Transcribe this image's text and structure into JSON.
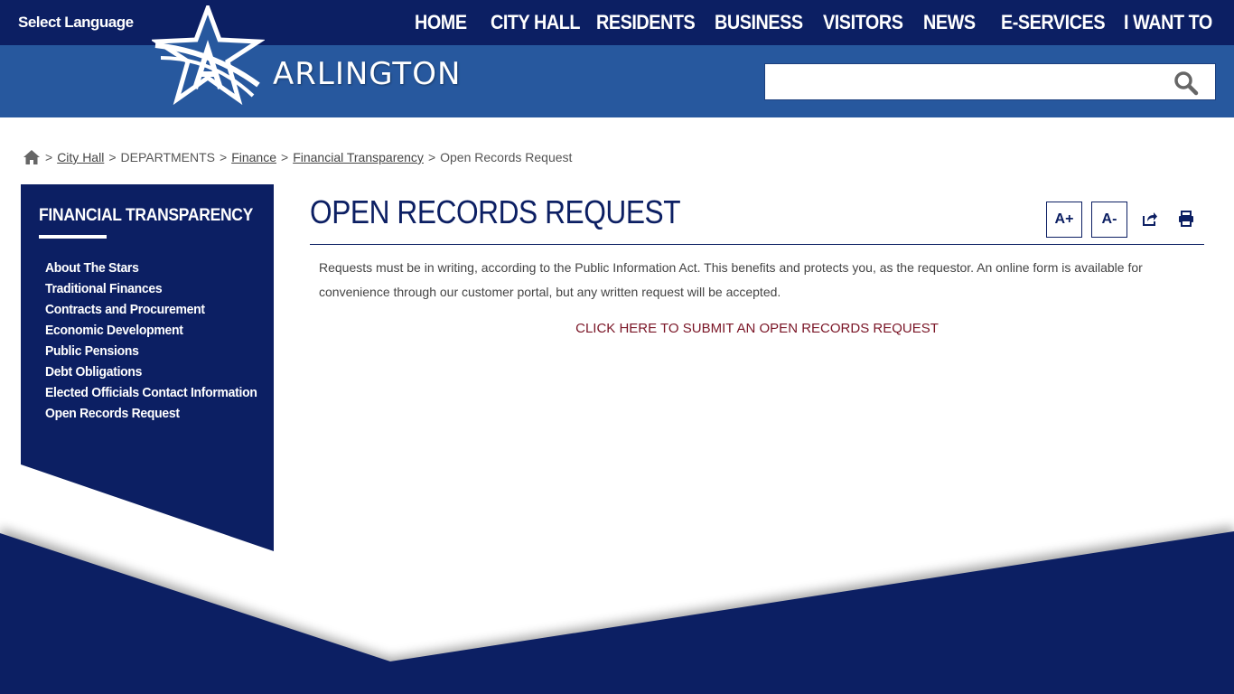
{
  "topbar": {
    "language": "Select Language",
    "nav": [
      "HOME",
      "CITY HALL",
      "RESIDENTS",
      "BUSINESS",
      "VISITORS",
      "NEWS",
      "E-SERVICES",
      "I WANT TO"
    ]
  },
  "header": {
    "brand": "ARLINGTON",
    "search_value": "",
    "search_icon": "search-icon"
  },
  "breadcrumb": {
    "home_icon": "home-icon",
    "sep": ">",
    "city_hall": "City Hall",
    "departments": "DEPARTMENTS",
    "finance": "Finance",
    "financial_transparency": "Financial Transparency",
    "current": "Open Records Request"
  },
  "sidebar": {
    "title": "FINANCIAL TRANSPARENCY",
    "items": [
      "About The Stars",
      "Traditional Finances",
      "Contracts and Procurement",
      "Economic Development",
      "Public Pensions",
      "Debt Obligations",
      "Elected Officials Contact Information",
      "Open Records Request"
    ]
  },
  "main": {
    "title": "OPEN RECORDS REQUEST",
    "tools": {
      "increase": "A+",
      "decrease": "A-",
      "share_icon": "share-icon",
      "print_icon": "print-icon"
    },
    "body": "Requests must be in writing, according to the Public Information Act. This benefits and protects you, as the requestor. An online form is available for convenience through our customer portal, but any written request will be accepted.",
    "cta": "CLICK HERE TO SUBMIT AN OPEN RECORDS REQUEST"
  },
  "colors": {
    "navy": "#0c1f63",
    "band_blue": "#27589e",
    "cta_red": "#7a1526"
  }
}
